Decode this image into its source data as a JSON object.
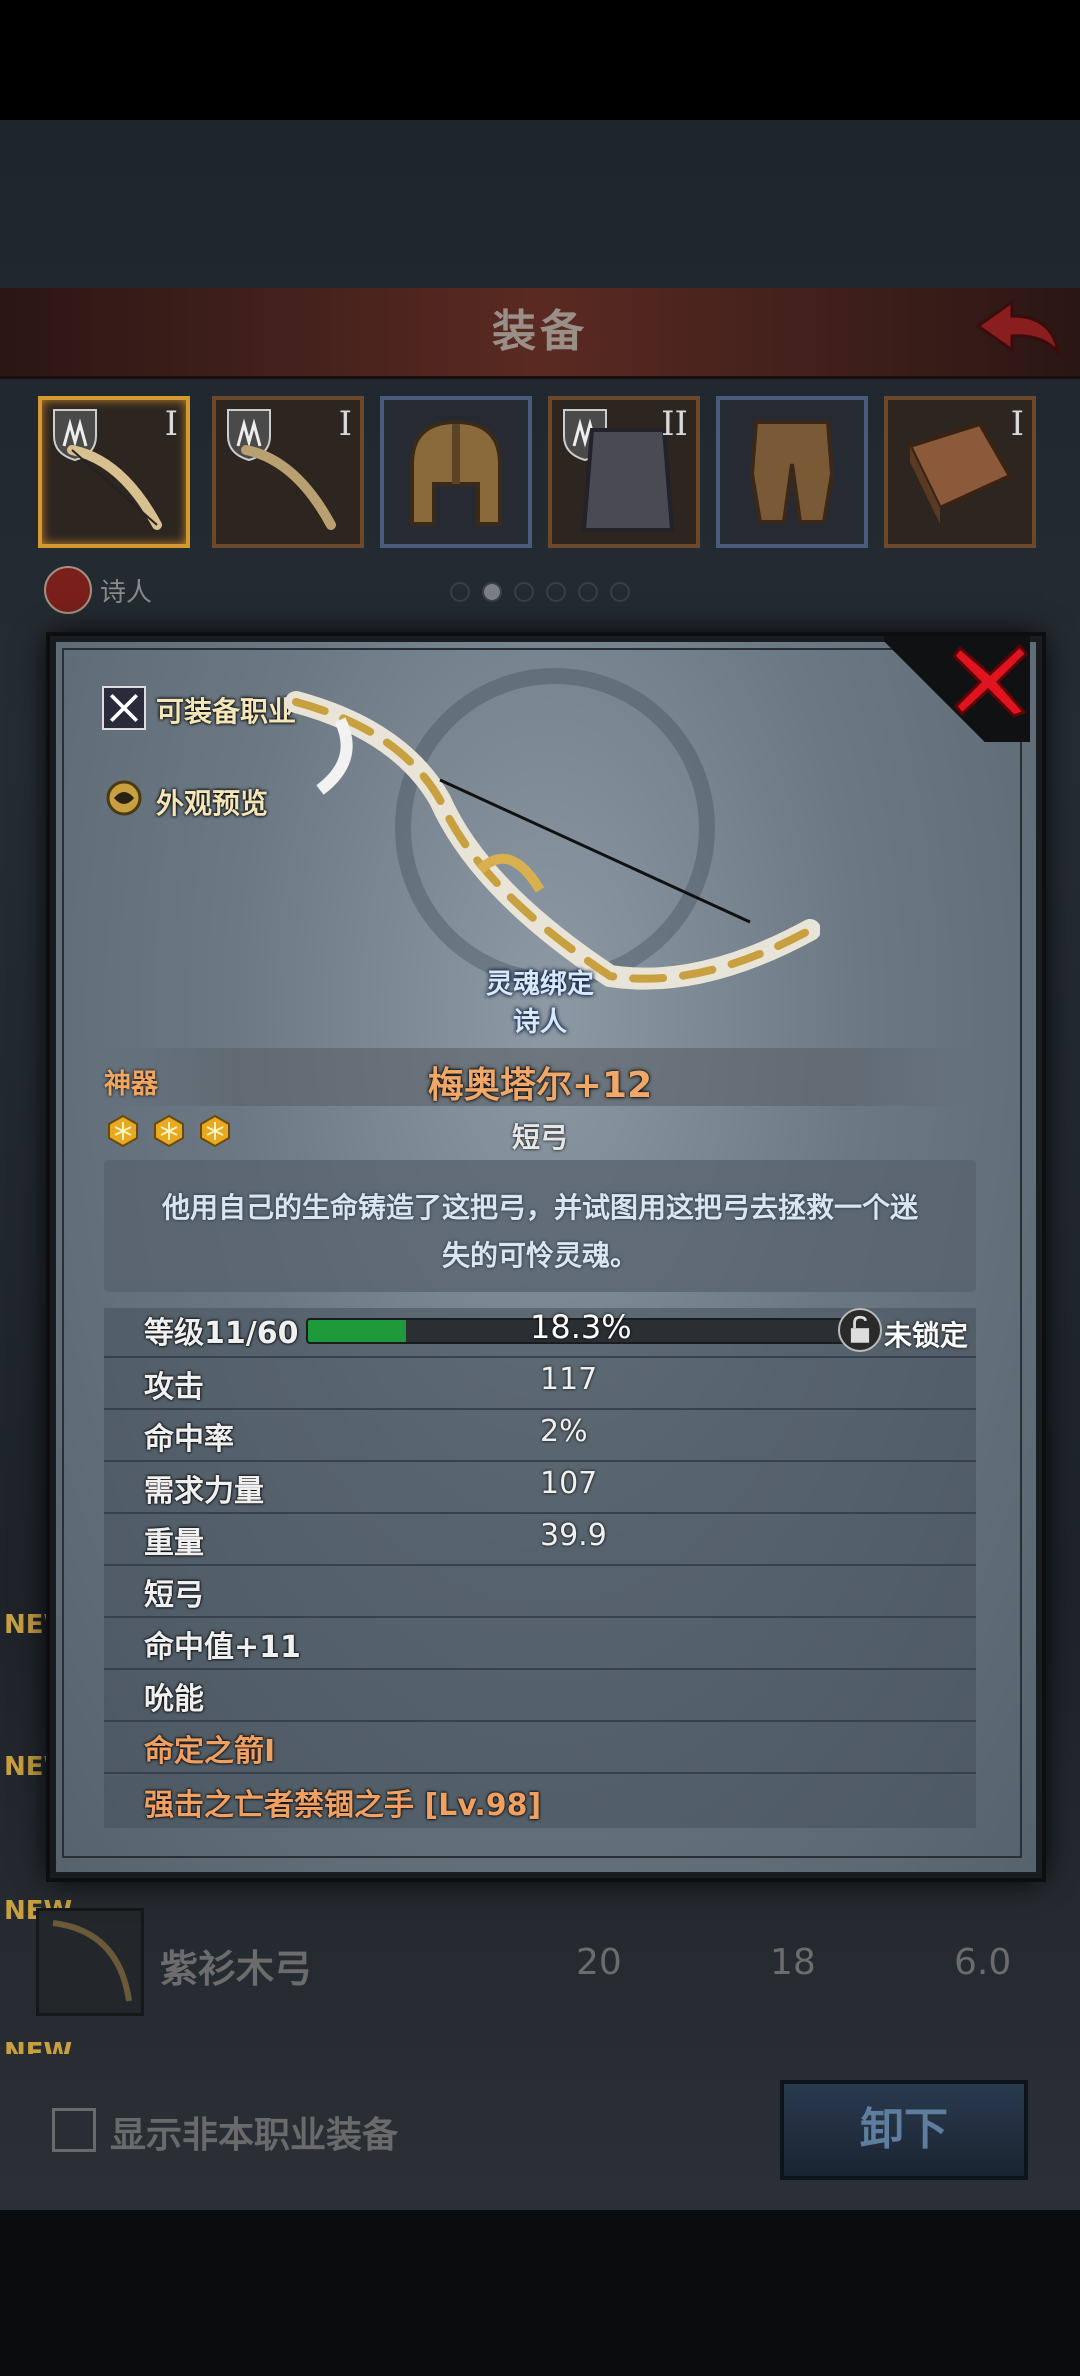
{
  "screen": {
    "header_title": "装备",
    "slots": [
      {
        "tier": "I",
        "kind": "bow",
        "selected": true
      },
      {
        "tier": "I",
        "kind": "bow",
        "selected": false
      },
      {
        "tier": "",
        "kind": "helmet",
        "selected": false
      },
      {
        "tier": "II",
        "kind": "armor",
        "selected": false
      },
      {
        "tier": "",
        "kind": "pants",
        "selected": false
      },
      {
        "tier": "I",
        "kind": "book",
        "selected": false
      }
    ],
    "character_name": "诗人",
    "page_dots": 6,
    "active_dot": 1,
    "new_tag": "NEW",
    "list_item": {
      "name": "紫衫木弓",
      "values": [
        "20",
        "18",
        "6.0"
      ]
    },
    "show_other_class_label": "显示非本职业装备",
    "unequip_label": "卸下"
  },
  "modal": {
    "equippable_class_label": "可装备职业",
    "appearance_preview_label": "外观预览",
    "soulbound_label": "灵魂绑定",
    "soulbound_owner": "诗人",
    "rarity": "神器",
    "item_name": "梅奥塔尔+12",
    "item_type": "短弓",
    "stars": 3,
    "description": "他用自己的生命铸造了这把弓，并试图用这把弓去拯救一个迷失的可怜灵魂。",
    "level_label": "等级11/60",
    "level_progress": 0.183,
    "level_percent_text": "18.3%",
    "lock_label": "未锁定",
    "stats": [
      {
        "label": "攻击",
        "value": "117"
      },
      {
        "label": "命中率",
        "value": "2%"
      },
      {
        "label": "需求力量",
        "value": "107"
      },
      {
        "label": "重量",
        "value": "39.9"
      }
    ],
    "properties": [
      {
        "text": "短弓",
        "color": "white"
      },
      {
        "text": "命中值+11",
        "color": "white"
      },
      {
        "text": "吮能",
        "color": "white"
      },
      {
        "text": "命定之箭I",
        "color": "orange"
      },
      {
        "text": "强击之亡者禁锢之手 [Lv.98]",
        "color": "orange"
      }
    ],
    "colors": {
      "accent_orange": "#f0a060",
      "progress_green": "#1e9a3a",
      "close_red": "#e0141e"
    }
  }
}
